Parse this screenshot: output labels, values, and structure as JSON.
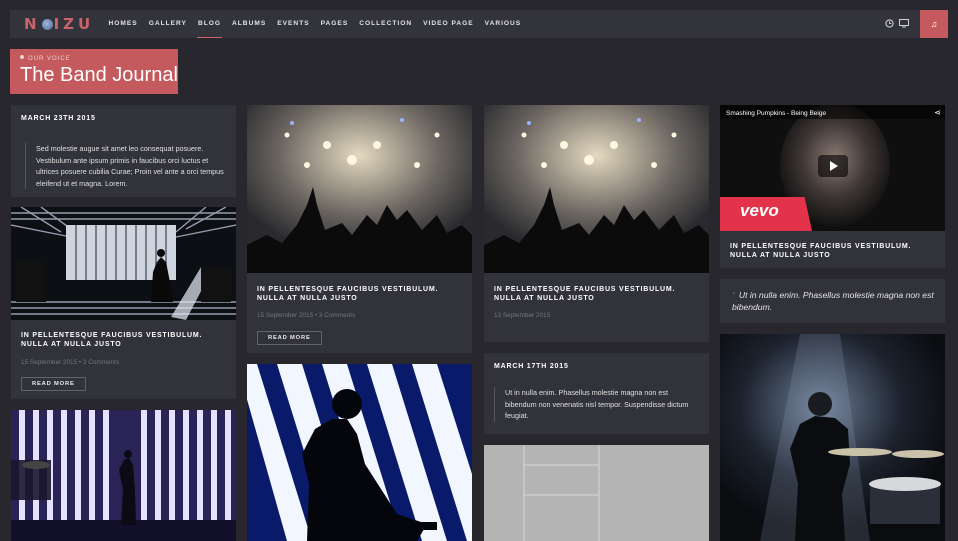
{
  "header": {
    "logo_text_a": "N",
    "logo_text_b": "IZU",
    "nav": [
      "HOMES",
      "GALLERY",
      "BLOG",
      "ALBUMS",
      "EVENTS",
      "PAGES",
      "COLLECTION",
      "VIDEO PAGE",
      "VARIOUS"
    ],
    "active_nav": "BLOG",
    "icons": [
      "clock-icon",
      "monitor-icon",
      "music-icon"
    ]
  },
  "page": {
    "subtitle": "OUR VOICE",
    "title": "The Band Journal"
  },
  "posts": {
    "quote1_date": "MARCH 23TH 2015",
    "quote1_text": "Sed molestie augue sit amet leo consequat posuere. Vestibulum ante ipsum primis in faucibus orci luctus et ultrices posuere cubilia Curae; Proin vel ante a orci tempus eleifend ut et magna. Lorem.",
    "post1_title": "IN PELLENTESQUE FAUCIBUS VESTIBULUM. NULLA AT NULLA JUSTO",
    "post1_meta": "15 September 2015 • 3 Comments",
    "post1_read": "READ MORE",
    "post2_title": "IN PELLENTESQUE FAUCIBUS VESTIBULUM. NULLA AT NULLA JUSTO",
    "post2_meta": "15 September 2015 • 3 Comments",
    "post2_read": "READ MORE",
    "post3_title": "IN PELLENTESQUE FAUCIBUS VESTIBULUM. NULLA AT NULLA JUSTO",
    "post3_meta": "13 September 2015",
    "quote2_date": "MARCH 17TH 2015",
    "quote2_text": "Ut in nulla enim. Phasellus molestie magna non est bibendum non venenatis nisl tempor. Suspendisse dictum feugiat.",
    "video_title": "Smashing Pumpkins - Being Beige",
    "video_logo": "vevo",
    "post4_title": "IN PELLENTESQUE FAUCIBUS VESTIBULUM. NULLA AT NULLA JUSTO",
    "quote3_text": "Ut in nulla enim. Phasellus molestie magna non est bibendum."
  },
  "colors": {
    "accent": "#c55a5e",
    "bg": "#27272d",
    "card": "#31323a"
  }
}
